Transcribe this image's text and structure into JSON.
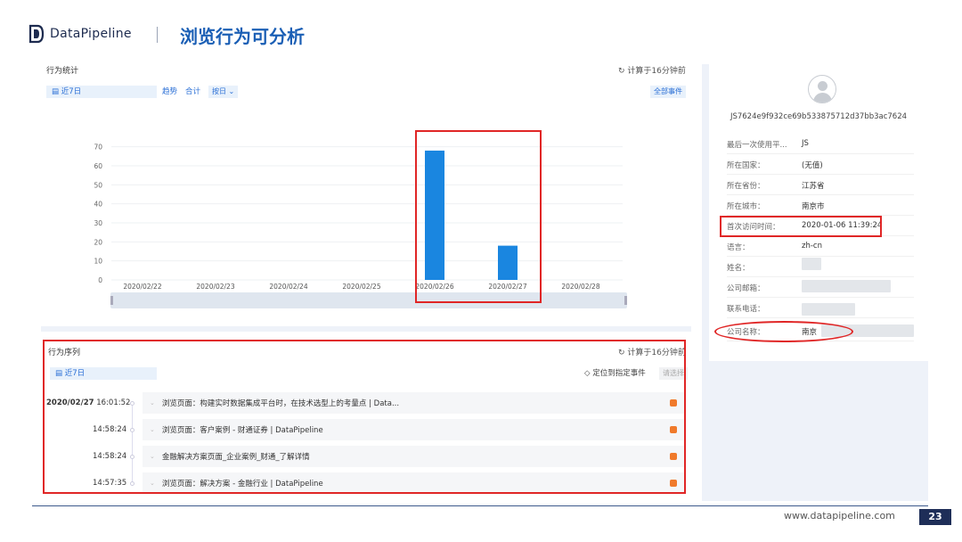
{
  "header": {
    "logo_text": "DataPipeline",
    "page_title": "浏览行为可分析"
  },
  "stats": {
    "label": "行为统计",
    "refresh": "计算于16分钟前",
    "date_range": "近7日",
    "tab_trend": "趋势",
    "tab_total": "合计",
    "granularity": "按日",
    "all_events": "全部事件"
  },
  "chart_data": {
    "type": "bar",
    "categories": [
      "2020/02/22",
      "2020/02/23",
      "2020/02/24",
      "2020/02/25",
      "2020/02/26",
      "2020/02/27",
      "2020/02/28"
    ],
    "values": [
      0,
      0,
      0,
      0,
      68,
      18,
      0
    ],
    "yticks": [
      0,
      10,
      20,
      30,
      40,
      50,
      60,
      70
    ],
    "ylim": [
      0,
      75
    ],
    "bar_color": "#1a86e0",
    "grid": true,
    "highlight_categories": [
      "2020/02/26",
      "2020/02/27"
    ],
    "highlight_color": "#e02626"
  },
  "sequence": {
    "label": "行为序列",
    "refresh": "计算于16分钟前",
    "date_range": "近7日",
    "locate_event": "定位到指定事件",
    "select_placeholder": "请选择",
    "date": "2020/02/27",
    "rows": [
      {
        "time": "16:01:52",
        "text": "浏览页面：构建实时数据集成平台时，在技术选型上的考量点 | Data..."
      },
      {
        "time": "14:58:24",
        "text": "浏览页面：客户案例 - 财通证券 | DataPipeline"
      },
      {
        "time": "14:58:24",
        "text": "金融解决方案页面_企业案例_财通_了解详情"
      },
      {
        "time": "14:57:35",
        "text": "浏览页面：解决方案 - 金融行业 | DataPipeline"
      }
    ]
  },
  "profile": {
    "uid": "JS7624e9f932ce69b533875712d37bb3ac7624",
    "fields": [
      {
        "key": "最后一次使用平...",
        "value": "JS"
      },
      {
        "key": "所在国家：",
        "value": "(无值)"
      },
      {
        "key": "所在省份：",
        "value": "江苏省"
      },
      {
        "key": "所在城市：",
        "value": "南京市"
      },
      {
        "key": "首次访问时间：",
        "value": "2020-01-06 11:39:24"
      },
      {
        "key": "语言：",
        "value": "zh-cn"
      },
      {
        "key": "姓名：",
        "value": ""
      },
      {
        "key": "公司邮箱：",
        "value": ""
      },
      {
        "key": "联系电话：",
        "value": ""
      },
      {
        "key": "公司名称：",
        "value": "南京"
      }
    ]
  },
  "footer": {
    "url": "www.datapipeline.com",
    "page_number": "23"
  },
  "colors": {
    "accent": "#1b5fb5",
    "highlight": "#e02626",
    "footer_badge": "#1e2e58"
  }
}
